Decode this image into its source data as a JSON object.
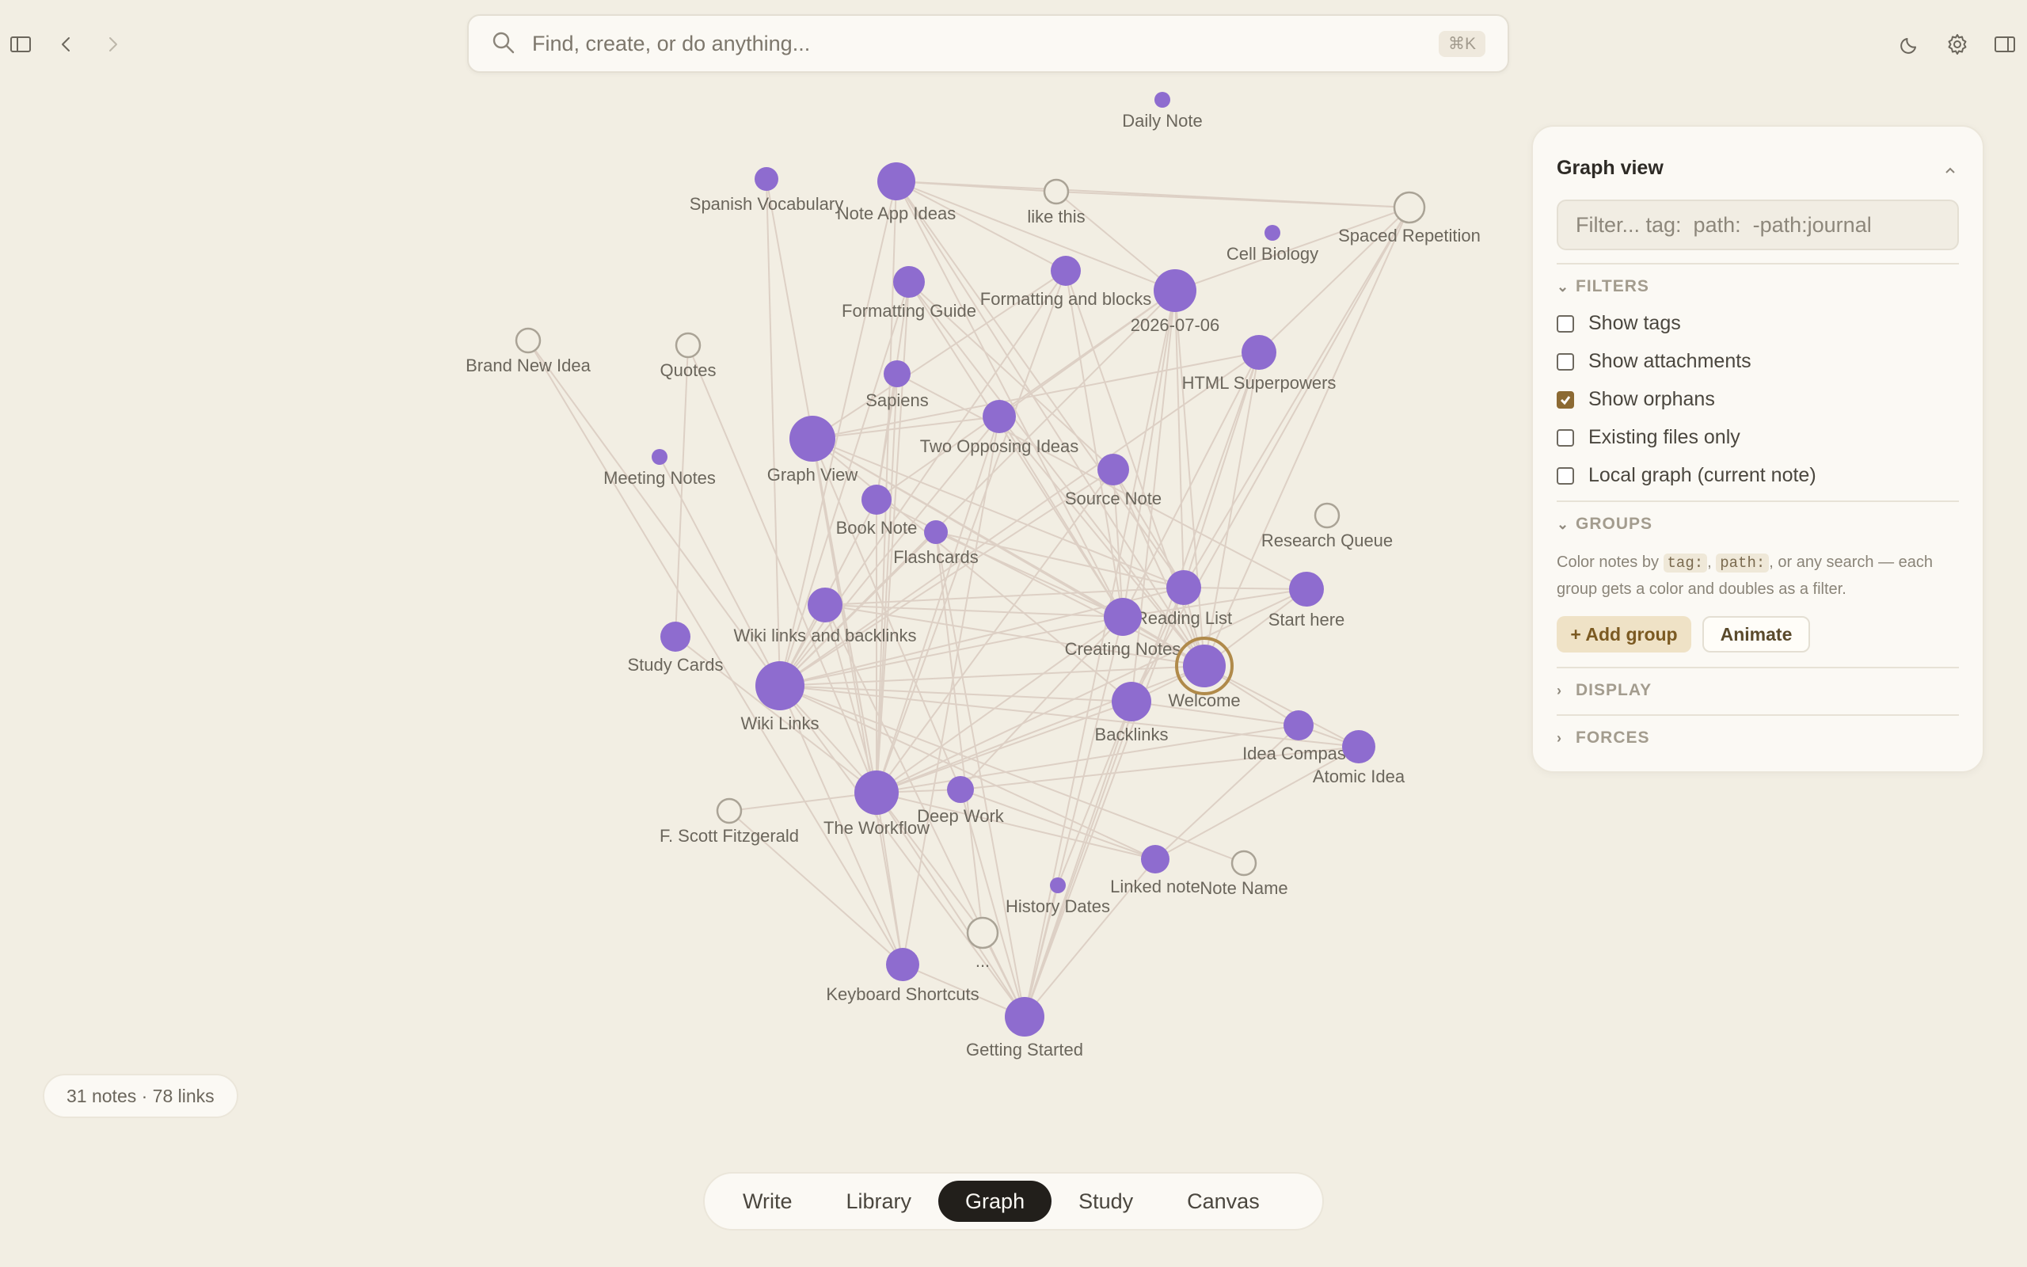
{
  "topbar": {
    "sidebar_toggle_icon": "sidebar-icon",
    "back_icon": "chevron-left-icon",
    "forward_icon": "chevron-right-icon",
    "theme_icon": "moon-icon",
    "settings_icon": "gear-icon",
    "panel_toggle_icon": "right-panel-icon"
  },
  "search": {
    "placeholder": "Find, create, or do anything...",
    "shortcut": "⌘K"
  },
  "graph": {
    "node_color": "#8e6ccf",
    "link_color": "#ddd0c5",
    "active_ring_color": "#b08a4a",
    "nodes": [
      {
        "id": "daily",
        "label": "Daily Note",
        "r": 10,
        "ghost": false
      },
      {
        "id": "spanish",
        "label": "Spanish Vocabulary",
        "r": 15,
        "ghost": false
      },
      {
        "id": "noteapp",
        "label": "Note App Ideas",
        "r": 24,
        "ghost": false
      },
      {
        "id": "likethis",
        "label": "like this",
        "r": 15,
        "ghost": true
      },
      {
        "id": "spaced",
        "label": "Spaced Repetition",
        "r": 19,
        "ghost": true
      },
      {
        "id": "cellbio",
        "label": "Cell Biology",
        "r": 10,
        "ghost": false
      },
      {
        "id": "formatguide",
        "label": "Formatting Guide",
        "r": 20,
        "ghost": false
      },
      {
        "id": "formatblocks",
        "label": "Formatting and blocks",
        "r": 19,
        "ghost": false
      },
      {
        "id": "date",
        "label": "2026-07-06",
        "r": 27,
        "ghost": false
      },
      {
        "id": "brandnew",
        "label": "Brand New Idea",
        "r": 15,
        "ghost": true
      },
      {
        "id": "quotes",
        "label": "Quotes",
        "r": 15,
        "ghost": true
      },
      {
        "id": "htmlsuper",
        "label": "HTML Superpowers",
        "r": 22,
        "ghost": false
      },
      {
        "id": "sapiens",
        "label": "Sapiens",
        "r": 17,
        "ghost": false
      },
      {
        "id": "twoopposing",
        "label": "Two Opposing Ideas",
        "r": 21,
        "ghost": false
      },
      {
        "id": "meeting",
        "label": "Meeting Notes",
        "r": 10,
        "ghost": false
      },
      {
        "id": "graphview",
        "label": "Graph View",
        "r": 29,
        "ghost": false
      },
      {
        "id": "sourcenote",
        "label": "Source Note",
        "r": 20,
        "ghost": false
      },
      {
        "id": "booknote",
        "label": "Book Note",
        "r": 19,
        "ghost": false
      },
      {
        "id": "flashcards",
        "label": "Flashcards",
        "r": 15,
        "ghost": false
      },
      {
        "id": "research",
        "label": "Research Queue",
        "r": 15,
        "ghost": true
      },
      {
        "id": "readinglist",
        "label": "Reading List",
        "r": 22,
        "ghost": false
      },
      {
        "id": "starthere",
        "label": "Start here",
        "r": 22,
        "ghost": false
      },
      {
        "id": "wikilinksback",
        "label": "Wiki links and backlinks",
        "r": 22,
        "ghost": false
      },
      {
        "id": "studycards",
        "label": "Study Cards",
        "r": 19,
        "ghost": false
      },
      {
        "id": "creating",
        "label": "Creating Notes",
        "r": 24,
        "ghost": false
      },
      {
        "id": "welcome",
        "label": "Welcome",
        "r": 27,
        "ghost": false,
        "active": true
      },
      {
        "id": "wikilinks",
        "label": "Wiki Links",
        "r": 31,
        "ghost": false
      },
      {
        "id": "backlinks",
        "label": "Backlinks",
        "r": 25,
        "ghost": false
      },
      {
        "id": "ideacompass",
        "label": "Idea Compass",
        "r": 19,
        "ghost": false
      },
      {
        "id": "atomic",
        "label": "Atomic Idea",
        "r": 21,
        "ghost": false
      },
      {
        "id": "fscott",
        "label": "F. Scott Fitzgerald",
        "r": 15,
        "ghost": true
      },
      {
        "id": "workflow",
        "label": "The Workflow",
        "r": 28,
        "ghost": false
      },
      {
        "id": "deepwork",
        "label": "Deep Work",
        "r": 17,
        "ghost": false
      },
      {
        "id": "linked",
        "label": "Linked note",
        "r": 18,
        "ghost": false
      },
      {
        "id": "notename",
        "label": "Note Name",
        "r": 15,
        "ghost": true
      },
      {
        "id": "history",
        "label": "History Dates",
        "r": 10,
        "ghost": false
      },
      {
        "id": "dots",
        "label": "...",
        "r": 19,
        "ghost": true
      },
      {
        "id": "keyboard",
        "label": "Keyboard Shortcuts",
        "r": 21,
        "ghost": false
      },
      {
        "id": "gettingstarted",
        "label": "Getting Started",
        "r": 25,
        "ghost": false
      }
    ],
    "links": [
      [
        "noteapp",
        "likethis"
      ],
      [
        "noteapp",
        "spaced"
      ],
      [
        "noteapp",
        "date"
      ],
      [
        "noteapp",
        "formatblocks"
      ],
      [
        "noteapp",
        "welcome"
      ],
      [
        "noteapp",
        "creating"
      ],
      [
        "noteapp",
        "wikilinks"
      ],
      [
        "noteapp",
        "workflow"
      ],
      [
        "noteapp",
        "readinglist"
      ],
      [
        "likethis",
        "spaced"
      ],
      [
        "likethis",
        "date"
      ],
      [
        "spaced",
        "date"
      ],
      [
        "spaced",
        "welcome"
      ],
      [
        "spaced",
        "readinglist"
      ],
      [
        "spaced",
        "htmlsuper"
      ],
      [
        "spaced",
        "backlinks"
      ],
      [
        "spanish",
        "wikilinks"
      ],
      [
        "spanish",
        "workflow"
      ],
      [
        "formatguide",
        "creating"
      ],
      [
        "formatguide",
        "workflow"
      ],
      [
        "formatguide",
        "wikilinks"
      ],
      [
        "formatguide",
        "welcome"
      ],
      [
        "formatguide",
        "sourcenote"
      ],
      [
        "formatguide",
        "booknote"
      ],
      [
        "formatblocks",
        "wikilinks"
      ],
      [
        "formatblocks",
        "welcome"
      ],
      [
        "formatblocks",
        "graphview"
      ],
      [
        "formatblocks",
        "creating"
      ],
      [
        "formatblocks",
        "workflow"
      ],
      [
        "date",
        "welcome"
      ],
      [
        "date",
        "readinglist"
      ],
      [
        "date",
        "wikilinks"
      ],
      [
        "date",
        "creating"
      ],
      [
        "date",
        "backlinks"
      ],
      [
        "date",
        "gettingstarted"
      ],
      [
        "date",
        "booknote"
      ],
      [
        "date",
        "twoopposing"
      ],
      [
        "brandnew",
        "wikilinks"
      ],
      [
        "brandnew",
        "keyboard"
      ],
      [
        "quotes",
        "studycards"
      ],
      [
        "quotes",
        "workflow"
      ],
      [
        "htmlsuper",
        "welcome"
      ],
      [
        "htmlsuper",
        "readinglist"
      ],
      [
        "htmlsuper",
        "wikilinks"
      ],
      [
        "htmlsuper",
        "creating"
      ],
      [
        "htmlsuper",
        "graphview"
      ],
      [
        "htmlsuper",
        "gettingstarted"
      ],
      [
        "sapiens",
        "workflow"
      ],
      [
        "sapiens",
        "booknote"
      ],
      [
        "sapiens",
        "starthere"
      ],
      [
        "twoopposing",
        "wikilinks"
      ],
      [
        "twoopposing",
        "welcome"
      ],
      [
        "twoopposing",
        "creating"
      ],
      [
        "twoopposing",
        "workflow"
      ],
      [
        "twoopposing",
        "keyboard"
      ],
      [
        "twoopposing",
        "graphview"
      ],
      [
        "meeting",
        "wikilinks"
      ],
      [
        "graphview",
        "welcome"
      ],
      [
        "graphview",
        "readinglist"
      ],
      [
        "graphview",
        "creating"
      ],
      [
        "graphview",
        "workflow"
      ],
      [
        "graphview",
        "backlinks"
      ],
      [
        "graphview",
        "keyboard"
      ],
      [
        "graphview",
        "deepwork"
      ],
      [
        "sourcenote",
        "wikilinks"
      ],
      [
        "sourcenote",
        "welcome"
      ],
      [
        "sourcenote",
        "workflow"
      ],
      [
        "sourcenote",
        "creating"
      ],
      [
        "sourcenote",
        "readinglist"
      ],
      [
        "booknote",
        "workflow"
      ],
      [
        "booknote",
        "wikilinks"
      ],
      [
        "booknote",
        "welcome"
      ],
      [
        "flashcards",
        "wikilinks"
      ],
      [
        "flashcards",
        "readinglist"
      ],
      [
        "flashcards",
        "gettingstarted"
      ],
      [
        "flashcards",
        "creating"
      ],
      [
        "flashcards",
        "dots"
      ],
      [
        "readinglist",
        "welcome"
      ],
      [
        "readinglist",
        "starthere"
      ],
      [
        "readinglist",
        "wikilinks"
      ],
      [
        "readinglist",
        "backlinks"
      ],
      [
        "readinglist",
        "gettingstarted"
      ],
      [
        "readinglist",
        "wikilinksback"
      ],
      [
        "starthere",
        "welcome"
      ],
      [
        "starthere",
        "workflow"
      ],
      [
        "starthere",
        "creating"
      ],
      [
        "wikilinksback",
        "wikilinks"
      ],
      [
        "wikilinksback",
        "welcome"
      ],
      [
        "wikilinksback",
        "creating"
      ],
      [
        "wikilinksback",
        "workflow"
      ],
      [
        "wikilinksback",
        "gettingstarted"
      ],
      [
        "studycards",
        "workflow"
      ],
      [
        "creating",
        "welcome"
      ],
      [
        "creating",
        "wikilinks"
      ],
      [
        "creating",
        "workflow"
      ],
      [
        "creating",
        "gettingstarted"
      ],
      [
        "creating",
        "deepwork"
      ],
      [
        "welcome",
        "wikilinks"
      ],
      [
        "welcome",
        "backlinks"
      ],
      [
        "welcome",
        "workflow"
      ],
      [
        "welcome",
        "ideacompass"
      ],
      [
        "welcome",
        "atomic"
      ],
      [
        "wikilinks",
        "backlinks"
      ],
      [
        "wikilinks",
        "workflow"
      ],
      [
        "wikilinks",
        "keyboard"
      ],
      [
        "wikilinks",
        "linked"
      ],
      [
        "wikilinks",
        "notename"
      ],
      [
        "wikilinks",
        "atomic"
      ],
      [
        "wikilinks",
        "gettingstarted"
      ],
      [
        "backlinks",
        "workflow"
      ],
      [
        "backlinks",
        "ideacompass"
      ],
      [
        "backlinks",
        "gettingstarted"
      ],
      [
        "backlinks",
        "history"
      ],
      [
        "ideacompass",
        "workflow"
      ],
      [
        "ideacompass",
        "atomic"
      ],
      [
        "ideacompass",
        "linked"
      ],
      [
        "atomic",
        "deepwork"
      ],
      [
        "atomic",
        "linked"
      ],
      [
        "fscott",
        "workflow"
      ],
      [
        "fscott",
        "keyboard"
      ],
      [
        "workflow",
        "deepwork"
      ],
      [
        "workflow",
        "keyboard"
      ],
      [
        "workflow",
        "gettingstarted"
      ],
      [
        "workflow",
        "dots"
      ],
      [
        "workflow",
        "linked"
      ],
      [
        "deepwork",
        "gettingstarted"
      ],
      [
        "deepwork",
        "linked"
      ],
      [
        "linked",
        "gettingstarted"
      ],
      [
        "history",
        "gettingstarted"
      ],
      [
        "dots",
        "gettingstarted"
      ],
      [
        "keyboard",
        "gettingstarted"
      ]
    ]
  },
  "panel": {
    "title": "Graph view",
    "collapse_icon": "chevron-up-icon",
    "filter_placeholder": "Filter... tag:  path:  -path:journal",
    "filters_heading": "FILTERS",
    "options": [
      {
        "label": "Show tags",
        "checked": false
      },
      {
        "label": "Show attachments",
        "checked": false
      },
      {
        "label": "Show orphans",
        "checked": true
      },
      {
        "label": "Existing files only",
        "checked": false
      },
      {
        "label": "Local graph (current note)",
        "checked": false
      }
    ],
    "groups_heading": "GROUPS",
    "groups_desc_1": "Color notes by ",
    "groups_code_1": "tag:",
    "groups_desc_2": ", ",
    "groups_code_2": "path:",
    "groups_desc_3": ", or any search — each group gets a color and doubles as a filter.",
    "add_group": "+ Add group",
    "animate": "Animate",
    "display_heading": "DISPLAY",
    "forces_heading": "FORCES"
  },
  "stats": "31 notes · 78 links",
  "tabs": [
    {
      "label": "Write",
      "active": false
    },
    {
      "label": "Library",
      "active": false
    },
    {
      "label": "Graph",
      "active": true
    },
    {
      "label": "Study",
      "active": false
    },
    {
      "label": "Canvas",
      "active": false
    }
  ]
}
